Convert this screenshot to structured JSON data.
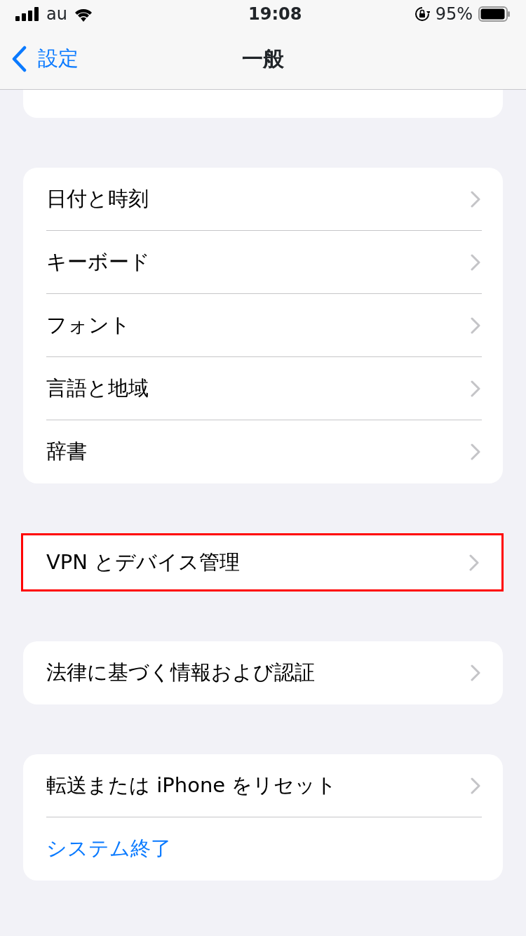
{
  "status_bar": {
    "carrier": "au",
    "time": "19:08",
    "battery": "95%"
  },
  "nav": {
    "back": "設定",
    "title": "一般"
  },
  "groups": [
    {
      "highlighted": false,
      "items": [
        {
          "label": "日付と時刻",
          "kind": "link"
        },
        {
          "label": "キーボード",
          "kind": "link"
        },
        {
          "label": "フォント",
          "kind": "link"
        },
        {
          "label": "言語と地域",
          "kind": "link"
        },
        {
          "label": "辞書",
          "kind": "link"
        }
      ]
    },
    {
      "highlighted": true,
      "items": [
        {
          "label": "VPN とデバイス管理",
          "kind": "link"
        }
      ]
    },
    {
      "highlighted": false,
      "items": [
        {
          "label": "法律に基づく情報および認証",
          "kind": "link"
        }
      ]
    },
    {
      "highlighted": false,
      "items": [
        {
          "label": "転送または iPhone をリセット",
          "kind": "link"
        },
        {
          "label": "システム終了",
          "kind": "action"
        }
      ]
    }
  ]
}
